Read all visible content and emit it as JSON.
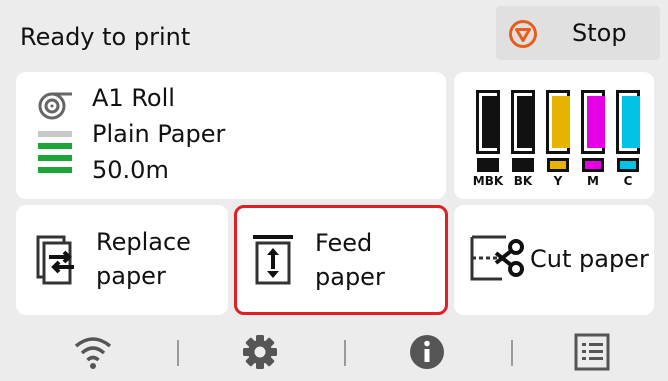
{
  "status": {
    "text": "Ready to print"
  },
  "stop": {
    "label": "Stop",
    "icon": "stop-icon",
    "icon_color": "#e85d1a"
  },
  "paper": {
    "roll": "A1 Roll",
    "type": "Plain Paper",
    "remaining": "50.0m",
    "roll_icon": "roll-paper-icon",
    "stack_icon": "paper-level-icon",
    "level_colors": {
      "empty": "#c8c8c8",
      "full": "#1ea53a"
    }
  },
  "inks": [
    {
      "name": "MBK",
      "color": "#111111",
      "level": 0.9
    },
    {
      "name": "BK",
      "color": "#111111",
      "level": 0.9
    },
    {
      "name": "Y",
      "color": "#e6b400",
      "level": 0.9
    },
    {
      "name": "M",
      "color": "#e600e6",
      "level": 0.9
    },
    {
      "name": "C",
      "color": "#00c4e6",
      "level": 0.9
    }
  ],
  "actions": {
    "replace": {
      "line1": "Replace",
      "line2": "paper",
      "icon": "replace-paper-icon"
    },
    "feed": {
      "line1": "Feed",
      "line2": "paper",
      "icon": "feed-paper-icon",
      "highlight_color": "#e01e25"
    },
    "cut": {
      "label": "Cut paper",
      "icon": "cut-paper-icon"
    }
  },
  "bottom": {
    "icons": [
      "wifi-icon",
      "settings-gear-icon",
      "info-icon",
      "job-list-icon"
    ]
  }
}
